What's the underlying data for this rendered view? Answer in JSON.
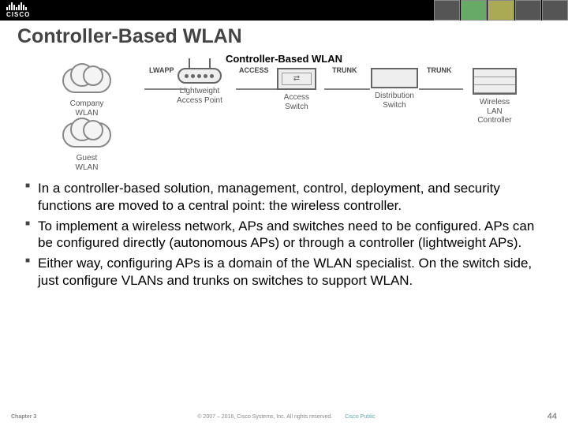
{
  "header": {
    "logo_text": "CISCO"
  },
  "title": "Controller-Based WLAN",
  "diagram": {
    "title": "Controller-Based WLAN",
    "company_cloud": "Company\nWLAN",
    "guest_cloud": "Guest\nWLAN",
    "link_lwapp": "LWAPP",
    "link_access": "ACCESS",
    "link_trunk1": "TRUNK",
    "link_trunk2": "TRUNK",
    "node_lap": "Lightweight\nAccess Point",
    "node_asw": "Access\nSwitch",
    "node_dsw": "Distribution\nSwitch",
    "node_wlc": "Wireless\nLAN\nController"
  },
  "bullets": [
    "In a controller-based solution, management, control, deployment, and security functions are moved to a central point: the wireless controller.",
    "To implement a wireless network, APs and switches need to be configured. APs can be configured directly (autonomous APs) or through a controller (lightweight APs).",
    "Either way, configuring APs is a domain of the WLAN specialist. On the switch side, just configure VLANs and trunks on switches to support WLAN."
  ],
  "footer": {
    "chapter": "Chapter 3",
    "copyright": "© 2007 – 2016, Cisco Systems, Inc. All rights reserved.",
    "cisco_public": "Cisco Public",
    "page": "44"
  }
}
